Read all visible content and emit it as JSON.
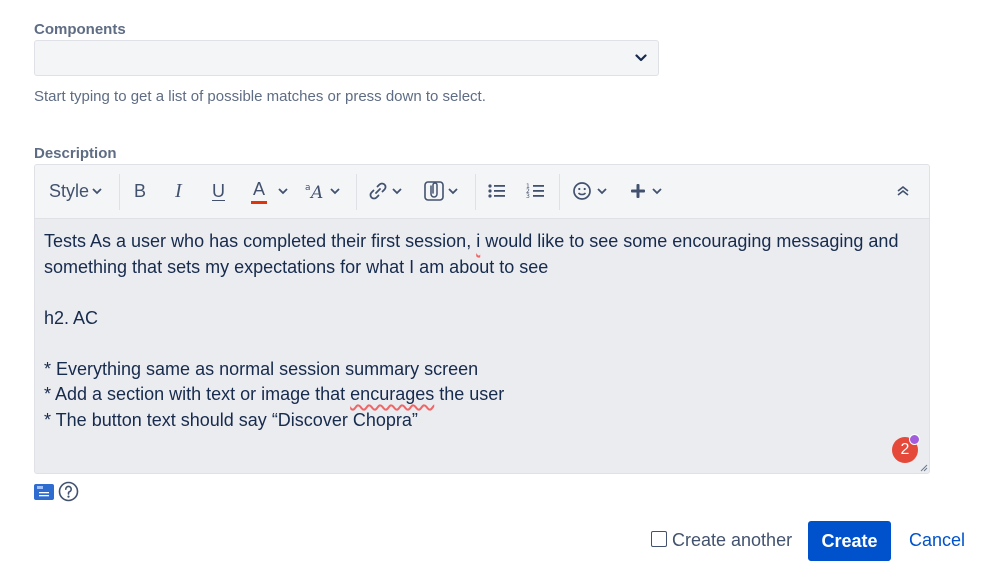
{
  "components": {
    "label": "Components",
    "selected_value": "",
    "hint": "Start typing to get a list of possible matches or press down to select."
  },
  "description": {
    "label": "Description",
    "toolbar": {
      "style_label": "Style",
      "bold_label": "B",
      "italic_label": "I",
      "underline_label": "U",
      "text_color_label": "A"
    },
    "lines": [
      "Tests As a user who has completed their first session, i would like to see some encouraging messaging and",
      "something that sets my expectations for what I am about to see",
      "",
      "h2. AC",
      "",
      "* Everything same as normal session summary screen",
      "* Add a section with text or image that encurages the user",
      "* The button text should say “Discover Chopra”"
    ],
    "badge_count": "2"
  },
  "footer": {
    "create_another_label": "Create another",
    "create_another_checked": false,
    "create_label": "Create",
    "cancel_label": "Cancel"
  },
  "colors": {
    "primary": "#0052cc",
    "badge": "#e5493a",
    "text_color_underline": "#de350b"
  }
}
